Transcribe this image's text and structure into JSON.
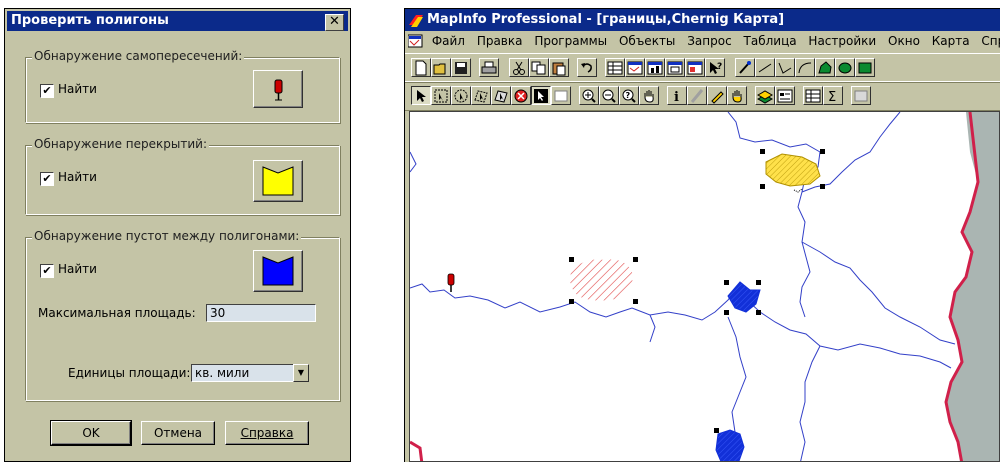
{
  "dialog": {
    "title": "Проверить полигоны",
    "close": "✕",
    "self_intersect": {
      "title": "Обнаружение самопересечений:",
      "find_label": "Найти",
      "checked": true
    },
    "overlap": {
      "title": "Обнаружение перекрытий:",
      "find_label": "Найти",
      "checked": true
    },
    "gaps": {
      "title": "Обнаружение пустот между полигонами:",
      "find_label": "Найти",
      "checked": true,
      "max_area_label": "Максимальная площадь:",
      "max_area_value": "30",
      "units_label": "Единицы площади:",
      "units_value": "кв. мили"
    },
    "buttons": {
      "ok": "OK",
      "cancel": "Отмена",
      "help": "Справка"
    },
    "colors": {
      "overlap_symbol": "#ffff00",
      "gap_symbol": "#0000ff",
      "pin": "#cc0000"
    }
  },
  "app": {
    "title": "MapInfo Professional - [границы,Chernig Карта]",
    "menu": [
      "Файл",
      "Правка",
      "Программы",
      "Объекты",
      "Запрос",
      "Таблица",
      "Настройки",
      "Окно",
      "Карта",
      "Справк"
    ],
    "toolbar1_icons": [
      "new-icon",
      "open-icon",
      "save-icon",
      "print-icon",
      "cut-icon",
      "copy-icon",
      "paste-icon",
      "undo-icon",
      "new-browser-icon",
      "new-mapper-icon",
      "new-grapher-icon",
      "new-layout-icon",
      "new-redistrict-icon",
      "help-pointer-icon",
      "line-style-icon",
      "line-icon",
      "polyline-icon",
      "arc-icon",
      "polygon-icon",
      "ellipse-icon",
      "rectangle-icon"
    ],
    "toolbar2_icons": [
      "select-icon",
      "marquee-select-icon",
      "radius-select-icon",
      "polygon-select-icon",
      "boundary-select-icon",
      "unselect-icon",
      "invert-select-icon",
      "graph-select-icon",
      "zoom-in-icon",
      "zoom-out-icon",
      "change-view-icon",
      "grabber-icon",
      "info-icon",
      "ruler-icon",
      "label-icon",
      "drag-window-icon",
      "layer-control-icon",
      "legend-icon",
      "statistics-icon",
      "sum-icon",
      "hotlink-icon"
    ],
    "colors": {
      "title_bar": "#0b2a8a",
      "border_lines": "#3340c8",
      "region_yellow": "#ffe14a",
      "region_blue": "#1230d8",
      "hatch_red": "#e04040",
      "sea": "#aab5b2",
      "red_border": "#d0204a"
    }
  }
}
